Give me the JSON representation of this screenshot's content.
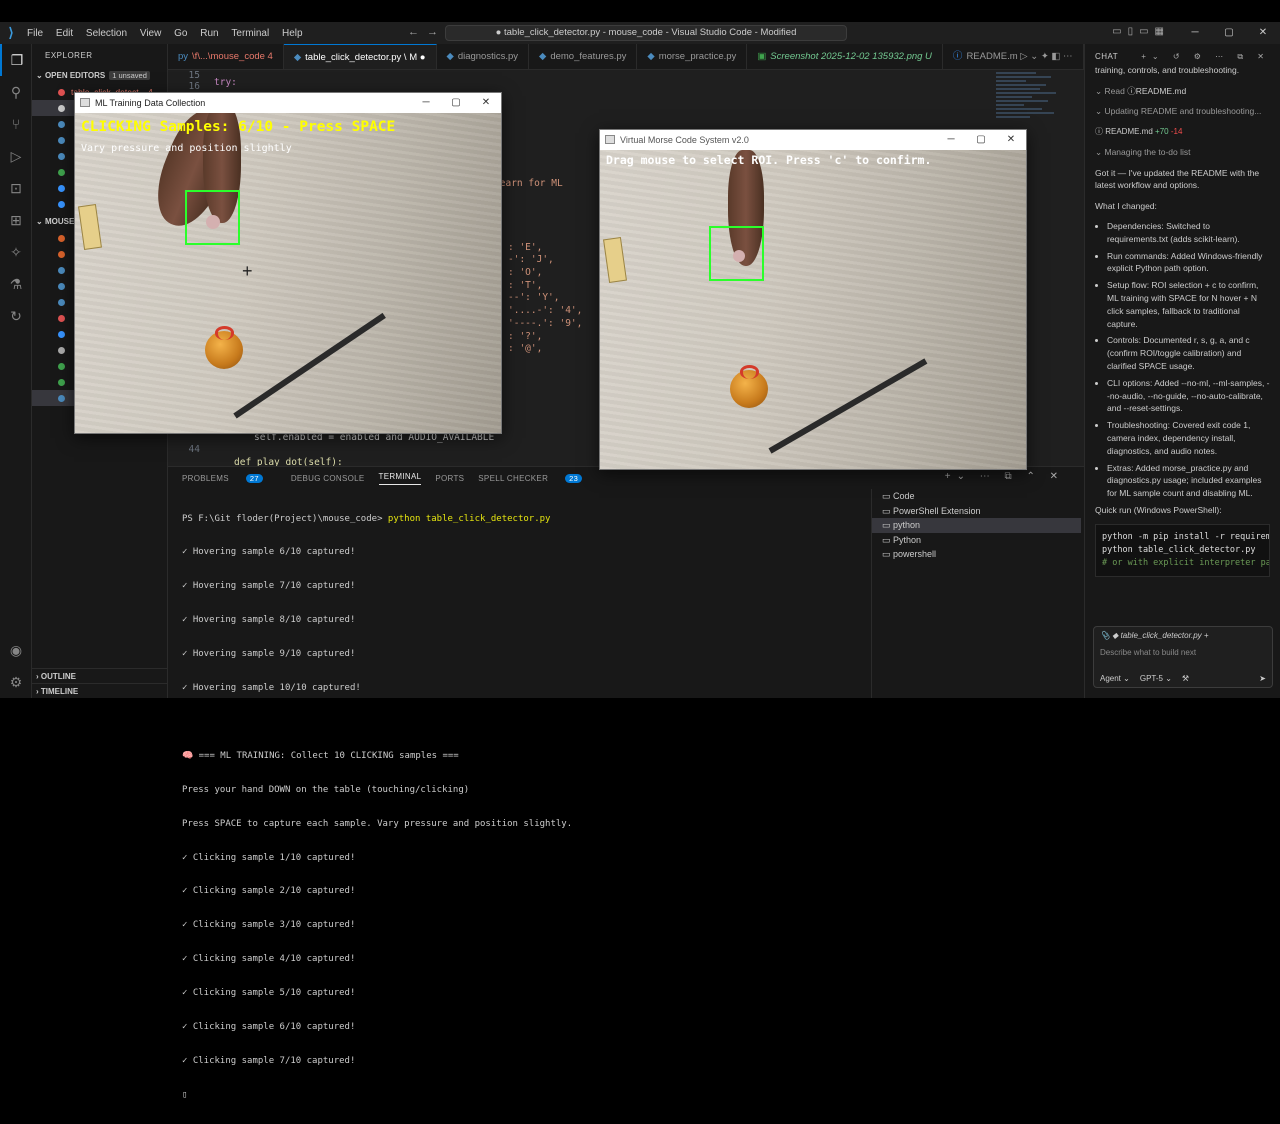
{
  "titlebar": {
    "menu": [
      "File",
      "Edit",
      "Selection",
      "View",
      "Go",
      "Run",
      "Terminal",
      "Help"
    ],
    "search": "● table_click_detector.py - mouse_code - Visual Studio Code - Modified"
  },
  "explorer": {
    "title": "EXPLORER",
    "open_editors": "OPEN EDITORS",
    "unsaved": "1 unsaved",
    "open_items": [
      "table_click_detect... 4"
    ],
    "folder": "MOUSE",
    "outline": "OUTLINE",
    "timeline": "TIMELINE"
  },
  "tabs": [
    {
      "label": "\\f\\...\\mouse_code 4"
    },
    {
      "label": "table_click_detector.py \\ M"
    },
    {
      "label": "diagnostics.py"
    },
    {
      "label": "demo_features.py"
    },
    {
      "label": "morse_practice.py"
    },
    {
      "label": "Screenshot 2025-12-02 135932.png U"
    },
    {
      "label": "README.m"
    }
  ],
  "editor": {
    "line_numbers": [
      "15",
      "16",
      "",
      "",
      "",
      "",
      "",
      "",
      "",
      "",
      "",
      "",
      "",
      "",
      "",
      "",
      "",
      "",
      "",
      "",
      "",
      "",
      "",
      "",
      "",
      "",
      "",
      "",
      "",
      "",
      "",
      "",
      "",
      "",
      "44",
      "45"
    ],
    "frag_try": "try:",
    "frag_sklearn": "scikit-learn for ML",
    "frag_e": ": 'E',",
    "frag_j": "-': 'J',",
    "frag_o": ": 'O',",
    "frag_t": ": 'T',",
    "frag_y": "--': 'Y',",
    "frag_4": "'....-': '4',",
    "frag_9": "'----.': '9',",
    "frag_q": ": '?',",
    "frag_at": ": '@',",
    "frag_enabled": "self.enabled = enabled and AUDIO_AVAILABLE",
    "frag_def": "def play_dot(self):"
  },
  "panel": {
    "tabs": [
      {
        "label": "PROBLEMS",
        "count": "27"
      },
      {
        "label": "DEBUG CONSOLE"
      },
      {
        "label": "TERMINAL"
      },
      {
        "label": "PORTS"
      },
      {
        "label": "SPELL CHECKER",
        "count": "23"
      }
    ],
    "prompt": "PS F:\\Git floder(Project)\\mouse_code>",
    "command": "python table_click_detector.py",
    "lines": [
      "✓ Hovering sample 6/10 captured!",
      "✓ Hovering sample 7/10 captured!",
      "✓ Hovering sample 8/10 captured!",
      "✓ Hovering sample 9/10 captured!",
      "✓ Hovering sample 10/10 captured!",
      "",
      "🧠 === ML TRAINING: Collect 10 CLICKING samples ===",
      "Press your hand DOWN on the table (touching/clicking)",
      "Press SPACE to capture each sample. Vary pressure and position slightly.",
      "✓ Clicking sample 1/10 captured!",
      "✓ Clicking sample 2/10 captured!",
      "✓ Clicking sample 3/10 captured!",
      "✓ Clicking sample 4/10 captured!",
      "✓ Clicking sample 5/10 captured!",
      "✓ Clicking sample 6/10 captured!",
      "✓ Clicking sample 7/10 captured!"
    ],
    "terminals": [
      "Code",
      "PowerShell Extension",
      "python",
      "Python",
      "powershell"
    ]
  },
  "chat": {
    "title": "CHAT",
    "intro": "training, controls, and troubleshooting.",
    "read_label": "Read",
    "read_file": "README.md",
    "updating": "Updating README and troubleshooting...",
    "diff_file": "README.md",
    "diff_add": "+70",
    "diff_del": "-14",
    "todo": "Managing the to-do list",
    "summary": "Got it — I've updated the README with the latest workflow and options.",
    "changed": "What I changed:",
    "bullets": [
      "Dependencies: Switched to requirements.txt (adds scikit-learn).",
      "Run commands: Added Windows-friendly explicit Python path option.",
      "Setup flow: ROI selection + c to confirm, ML training with SPACE for N hover + N click samples, fallback to traditional capture.",
      "Controls: Documented r, s, g, a, and c (confirm ROI/toggle calibration) and clarified SPACE usage.",
      "CLI options: Added --no-ml, --ml-samples, --no-audio, --no-guide, --no-auto-calibrate, and --reset-settings.",
      "Troubleshooting: Covered exit code 1, camera index, dependency install, diagnostics, and audio notes.",
      "Extras: Added morse_practice.py and diagnostics.py usage; included examples for ML sample count and disabling ML."
    ],
    "quick_run": "Quick run (Windows PowerShell):",
    "code_lines": [
      "python -m pip install -r requirem",
      "python table_click_detector.py"
    ],
    "code_comment": "# or with explicit interpreter pa",
    "context_file": "table_click_detector.py",
    "placeholder": "Describe what to build next",
    "mode": "Agent",
    "model": "GPT-5"
  },
  "ml_window": {
    "title": "ML Training Data Collection",
    "overlay_title": "CLICKING Samples: 6/10 - Press SPACE",
    "overlay_sub": "Vary pressure and position slightly",
    "overlay_color": "#ffff00"
  },
  "morse_window": {
    "title": "Virtual Morse Code System v2.0",
    "overlay_title": "Drag mouse to select ROI. Press 'c' to confirm."
  },
  "colors": {
    "accent": "#0078d4",
    "roi": "#2bff2b"
  }
}
